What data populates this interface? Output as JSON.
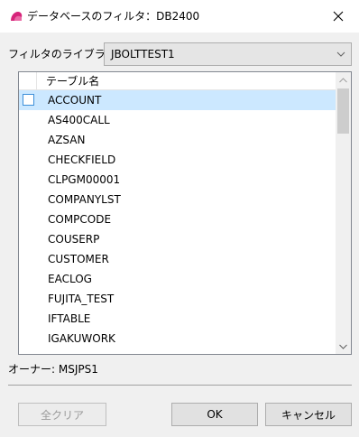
{
  "window": {
    "title": "データベースのフィルタ：DB2400",
    "close_icon": "close-icon",
    "app_icon": "app-icon",
    "app_icon_color": "#d6247a"
  },
  "library": {
    "label": "フィルタのライブラリ:",
    "selected": "JBOLTTEST1"
  },
  "list": {
    "header": "テーブル名",
    "rows": [
      "ACCOUNT",
      "AS400CALL",
      "AZSAN",
      "CHECKFIELD",
      "CLPGM00001",
      "COMPANYLST",
      "COMPCODE",
      "COUSERP",
      "CUSTOMER",
      "EACLOG",
      "FUJITA_TEST",
      "IFTABLE",
      "IGAKUWORK"
    ],
    "selected_index": 0,
    "selection_color": "#cce8ff"
  },
  "owner": {
    "label": "オーナー: MSJPS1"
  },
  "buttons": {
    "clear": "全クリア",
    "ok": "OK",
    "cancel": "キャンセル"
  }
}
